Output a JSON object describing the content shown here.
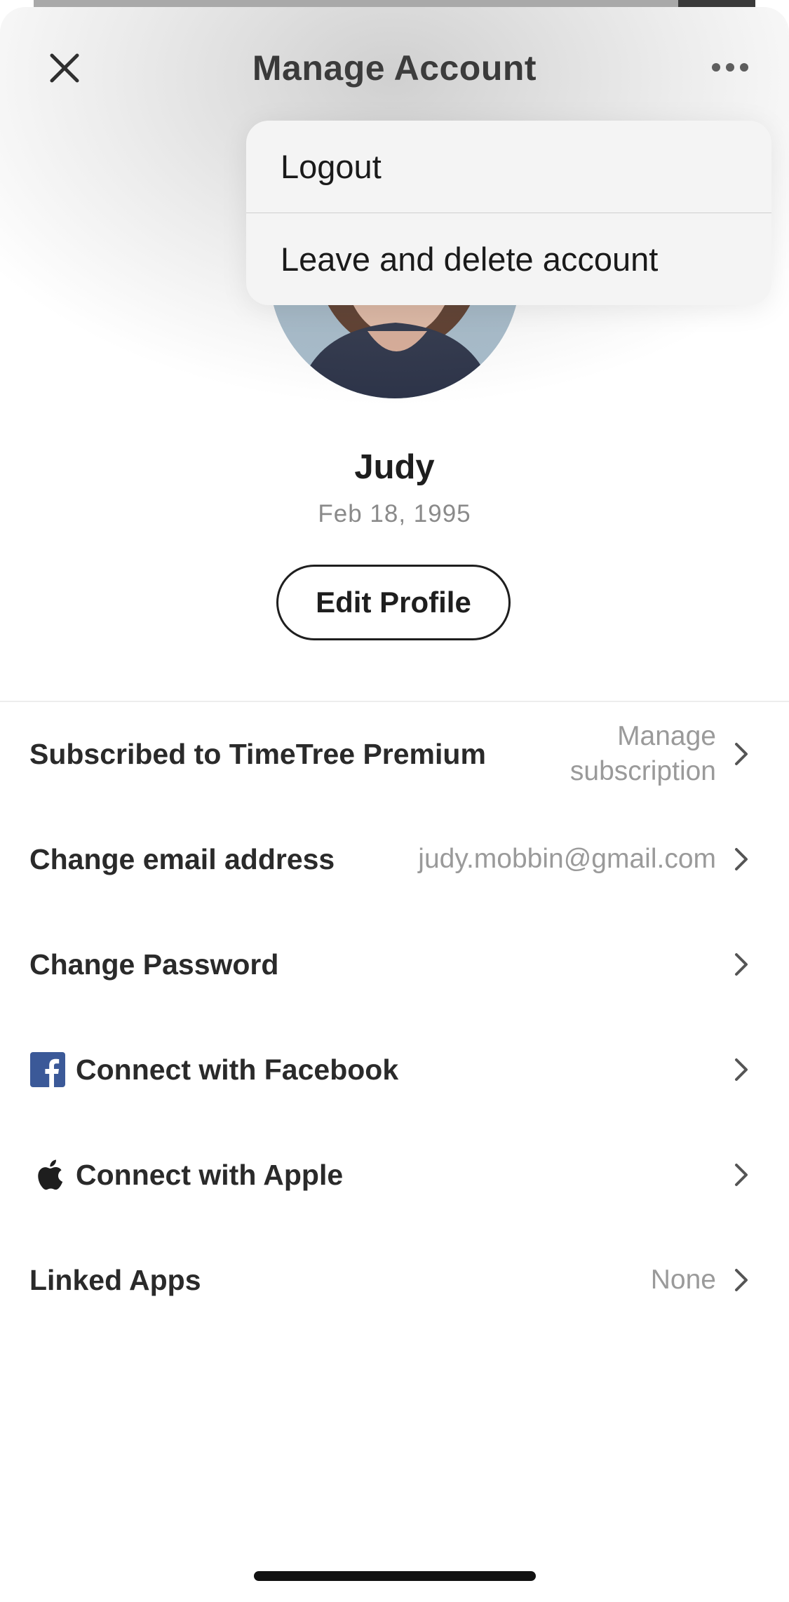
{
  "header": {
    "title": "Manage Account",
    "close_icon": "close-icon",
    "more_icon": "more-horizontal-icon"
  },
  "menu": {
    "items": [
      {
        "label": "Logout"
      },
      {
        "label": "Leave and delete account"
      }
    ]
  },
  "profile": {
    "name": "Judy",
    "birthday": "Feb 18, 1995",
    "edit_label": "Edit Profile"
  },
  "settings": {
    "premium": {
      "label": "Subscribed to TimeTree Premium",
      "value": "Manage subscription"
    },
    "email": {
      "label": "Change email address",
      "value": "judy.mobbin@gmail.com"
    },
    "password": {
      "label": "Change Password"
    },
    "facebook": {
      "label": "Connect with Facebook",
      "icon": "facebook-icon"
    },
    "apple": {
      "label": "Connect with Apple",
      "icon": "apple-icon"
    },
    "linked_apps": {
      "label": "Linked Apps",
      "value": "None"
    }
  },
  "colors": {
    "facebook_blue": "#3b5998",
    "text_primary": "#1e1e1e",
    "text_secondary": "#9a9a9a"
  }
}
